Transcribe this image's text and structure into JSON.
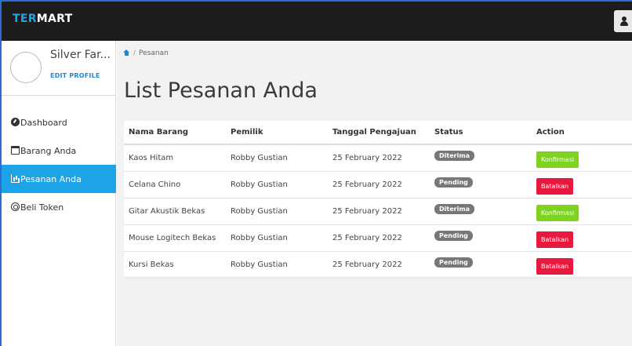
{
  "app": {
    "brand_prefix": "TER",
    "brand_suffix": "MART",
    "accent": "#20a7e0"
  },
  "profile": {
    "name": "Silver Far...",
    "edit_label": "EDIT PROFILE"
  },
  "sidebar": {
    "items": [
      {
        "label": "Dashboard",
        "icon": "dashboard-icon"
      },
      {
        "label": "Barang Anda",
        "icon": "calendar-icon"
      },
      {
        "label": "Pesanan Anda",
        "icon": "bar-chart-icon",
        "active": true
      },
      {
        "label": "Beli Token",
        "icon": "token-icon"
      }
    ]
  },
  "breadcrumb": {
    "home_icon": "home-icon",
    "current": "Pesanan"
  },
  "page": {
    "title": "List Pesanan Anda"
  },
  "table": {
    "headers": [
      "Nama Barang",
      "Pemilik",
      "Tanggal Pengajuan",
      "Status",
      "Action"
    ],
    "rows": [
      {
        "item": "Kaos Hitam",
        "owner": "Robby Gustian",
        "date": "25 February 2022",
        "status": "Diterima",
        "action": "Konfirmasi"
      },
      {
        "item": "Celana Chino",
        "owner": "Robby Gustian",
        "date": "25 February 2022",
        "status": "Pending",
        "action": "Batalkan"
      },
      {
        "item": "Gitar Akustik Bekas",
        "owner": "Robby Gustian",
        "date": "25 February 2022",
        "status": "Diterima",
        "action": "Konfirmasi"
      },
      {
        "item": "Mouse Logitech Bekas",
        "owner": "Robby Gustian",
        "date": "25 February 2022",
        "status": "Pending",
        "action": "Batalkan"
      },
      {
        "item": "Kursi Bekas",
        "owner": "Robby Gustian",
        "date": "25 February 2022",
        "status": "Pending",
        "action": "Batalkan"
      }
    ]
  },
  "colors": {
    "active_nav": "#1da3e8",
    "confirm": "#7ed321",
    "cancel": "#e8193f",
    "badge": "#777777"
  },
  "header": {
    "user_icon": "user-icon"
  }
}
